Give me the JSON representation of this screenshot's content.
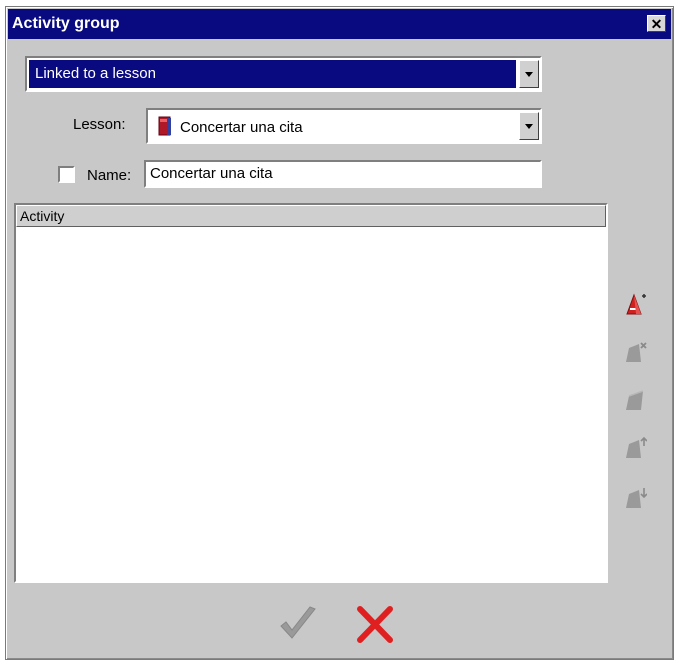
{
  "window": {
    "title": "Activity group",
    "close_glyph": "✕"
  },
  "link_mode": {
    "value": "Linked to a lesson"
  },
  "lesson": {
    "label": "Lesson:",
    "value": "Concertar una cita",
    "icon": "book-icon"
  },
  "name": {
    "label": "Name:",
    "checked": false,
    "value": "Concertar una cita"
  },
  "activity_list": {
    "header": "Activity",
    "items": []
  },
  "side_toolbar": [
    {
      "name": "add-activity-icon",
      "enabled": true
    },
    {
      "name": "remove-activity-icon",
      "enabled": false
    },
    {
      "name": "edit-activity-icon",
      "enabled": false
    },
    {
      "name": "move-up-icon",
      "enabled": false
    },
    {
      "name": "move-down-icon",
      "enabled": false
    }
  ],
  "footer": {
    "ok_icon": "checkmark-icon",
    "cancel_icon": "cross-icon"
  },
  "colors": {
    "titlebar": "#0a0a80",
    "selection": "#0a0a80",
    "cancel": "#e02020",
    "disabled_icon": "#9a9a9a"
  }
}
